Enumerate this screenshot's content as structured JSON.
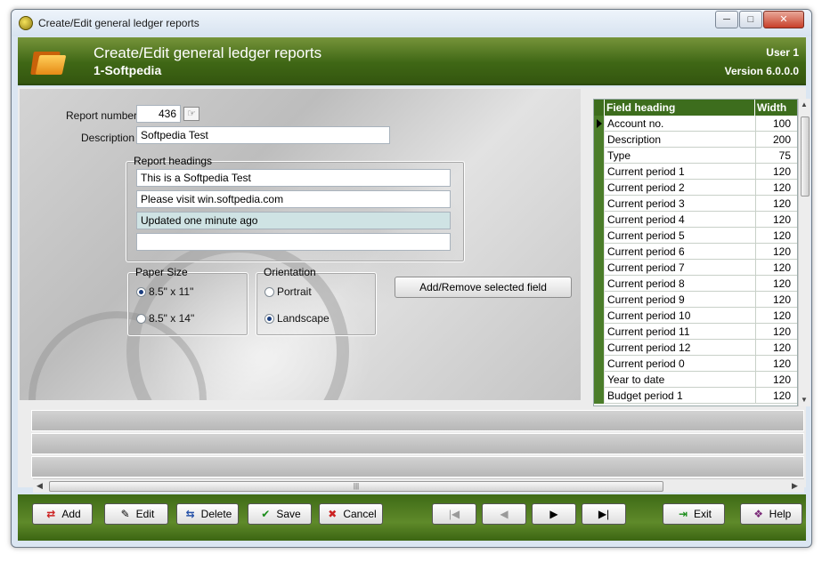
{
  "window": {
    "title": "Create/Edit general ledger reports",
    "controls": {
      "minimize": "─",
      "maximize": "□",
      "close": "✕"
    }
  },
  "header": {
    "title": "Create/Edit general ledger reports",
    "subtitle": "1-Softpedia",
    "user": "User 1",
    "version": "Version 6.0.0.0"
  },
  "form": {
    "report_number_label": "Report number",
    "report_number_value": "436",
    "description_label": "Description",
    "description_value": "Softpedia Test",
    "report_headings_label": "Report headings",
    "headings": [
      "This is a Softpedia Test",
      "Please visit win.softpedia.com",
      "Updated one minute ago",
      ""
    ],
    "paper_size_label": "Paper Size",
    "paper_sizes": [
      {
        "label": "8.5\" x 11\"",
        "selected": true
      },
      {
        "label": "8.5\" x 14\"",
        "selected": false
      }
    ],
    "orientation_label": "Orientation",
    "orientations": [
      {
        "label": "Portrait",
        "selected": false
      },
      {
        "label": "Landscape",
        "selected": true
      }
    ],
    "add_remove_button": "Add/Remove selected field"
  },
  "grid": {
    "columns": [
      "Field heading",
      "Width"
    ],
    "rows": [
      {
        "name": "Account no.",
        "width": "100",
        "current": true
      },
      {
        "name": "Description",
        "width": "200"
      },
      {
        "name": "Type",
        "width": "75"
      },
      {
        "name": "Current period 1",
        "width": "120"
      },
      {
        "name": "Current period 2",
        "width": "120"
      },
      {
        "name": "Current period 3",
        "width": "120"
      },
      {
        "name": "Current period 4",
        "width": "120"
      },
      {
        "name": "Current period 5",
        "width": "120"
      },
      {
        "name": "Current period 6",
        "width": "120"
      },
      {
        "name": "Current period 7",
        "width": "120"
      },
      {
        "name": "Current period 8",
        "width": "120"
      },
      {
        "name": "Current period 9",
        "width": "120"
      },
      {
        "name": "Current period 10",
        "width": "120"
      },
      {
        "name": "Current period 11",
        "width": "120"
      },
      {
        "name": "Current period 12",
        "width": "120"
      },
      {
        "name": "Current period 0",
        "width": "120"
      },
      {
        "name": "Year to date",
        "width": "120"
      },
      {
        "name": "Budget period 1",
        "width": "120"
      }
    ]
  },
  "toolbar": {
    "add": "Add",
    "edit": "Edit",
    "delete": "Delete",
    "save": "Save",
    "cancel": "Cancel",
    "first": "|◀",
    "prev": "◀",
    "next": "▶",
    "last": "▶|",
    "exit": "Exit",
    "help": "Help"
  },
  "colors": {
    "header_green": "#3f6715",
    "grid_header": "#3d6d1d",
    "row_indicator": "#4b7d2a"
  }
}
